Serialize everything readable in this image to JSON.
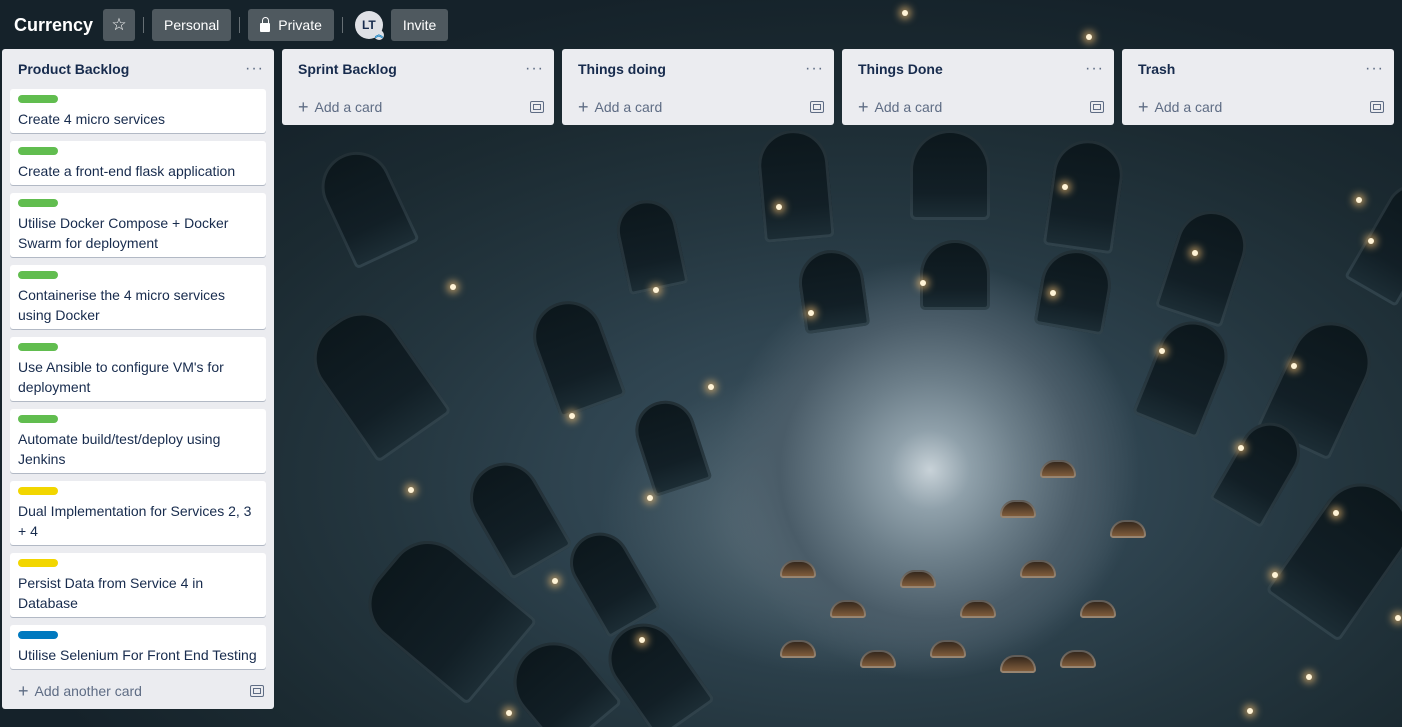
{
  "board": {
    "title": "Currency",
    "star_icon": "star-icon",
    "workspace_label": "Personal",
    "visibility_label": "Private",
    "lock_icon": "lock-icon",
    "member_initials": "LT",
    "invite_label": "Invite"
  },
  "lists": [
    {
      "title": "Product Backlog",
      "cards": [
        {
          "label_color": "#61bd4f",
          "text": "Create 4 micro services"
        },
        {
          "label_color": "#61bd4f",
          "text": "Create a front-end flask application"
        },
        {
          "label_color": "#61bd4f",
          "text": "Utilise Docker Compose + Docker Swarm for deployment"
        },
        {
          "label_color": "#61bd4f",
          "text": "Containerise the 4 micro services using Docker"
        },
        {
          "label_color": "#61bd4f",
          "text": "Use Ansible to configure VM's for deployment"
        },
        {
          "label_color": "#61bd4f",
          "text": "Automate build/test/deploy using Jenkins"
        },
        {
          "label_color": "#f2d600",
          "text": "Dual Implementation for Services 2, 3 + 4"
        },
        {
          "label_color": "#f2d600",
          "text": "Persist Data from Service 4 in Database"
        },
        {
          "label_color": "#0079bf",
          "text": "Utilise Selenium For Front End Testing"
        }
      ],
      "add_label": "Add another card"
    },
    {
      "title": "Sprint Backlog",
      "cards": [],
      "add_label": "Add a card"
    },
    {
      "title": "Things doing",
      "cards": [],
      "add_label": "Add a card"
    },
    {
      "title": "Things Done",
      "cards": [],
      "add_label": "Add a card"
    },
    {
      "title": "Trash",
      "cards": [],
      "add_label": "Add a card"
    }
  ],
  "icons": {
    "list_menu": "more-horizontal-icon",
    "add": "plus-icon",
    "template": "card-template-icon"
  }
}
